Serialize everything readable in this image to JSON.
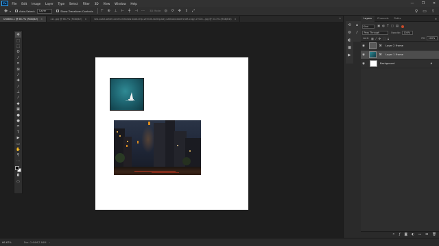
{
  "menu": {
    "logo": "Ps",
    "items": [
      "File",
      "Edit",
      "Image",
      "Layer",
      "Type",
      "Select",
      "Filter",
      "3D",
      "View",
      "Window",
      "Help"
    ]
  },
  "window_controls": {
    "minimize": "—",
    "restore": "❐",
    "close": "✕"
  },
  "options_bar": {
    "auto_select_label": "Auto-Select:",
    "auto_select_value": "Layer",
    "transform_controls_label": "Show Transform Controls",
    "mode_3d_label": "3D Mode:"
  },
  "tabs": [
    {
      "title": "Untitled-1 @ 66.7% (RGB/8#)",
      "active": true
    },
    {
      "title": "111.jpg @ 66.7% (RGB/8#)",
      "active": false
    },
    {
      "title": "sea-coast-water-ocean-meadow-boat-ship-vehicle-sailing-bay-sailboat-watercraft-copy-1700x...jpg @ 33.3% (RGB/8#)",
      "active": false
    }
  ],
  "tools": [
    {
      "icon": "move-icon",
      "glyph": "✥"
    },
    {
      "icon": "artboard-icon",
      "glyph": "⬚"
    },
    {
      "icon": "marquee-icon",
      "glyph": "⬚"
    },
    {
      "icon": "lasso-icon",
      "glyph": "ʘ"
    },
    {
      "icon": "quick-select-icon",
      "glyph": "⁄"
    },
    {
      "icon": "crop-icon",
      "glyph": "⌗"
    },
    {
      "icon": "frame-icon",
      "glyph": "⊠"
    },
    {
      "icon": "eyedropper-icon",
      "glyph": "⁄"
    },
    {
      "icon": "healing-icon",
      "glyph": "✚"
    },
    {
      "icon": "brush-icon",
      "glyph": "⁄"
    },
    {
      "icon": "stamp-icon",
      "glyph": "⊥"
    },
    {
      "icon": "history-brush-icon",
      "glyph": "⁄"
    },
    {
      "icon": "eraser-icon",
      "glyph": "◆"
    },
    {
      "icon": "gradient-icon",
      "glyph": "▣"
    },
    {
      "icon": "blur-icon",
      "glyph": "●"
    },
    {
      "icon": "dodge-icon",
      "glyph": "●"
    },
    {
      "icon": "pen-icon",
      "glyph": "✒"
    },
    {
      "icon": "type-icon",
      "glyph": "T"
    },
    {
      "icon": "path-select-icon",
      "glyph": "▶"
    },
    {
      "icon": "rectangle-icon",
      "glyph": "▭"
    },
    {
      "icon": "hand-icon",
      "glyph": "✋"
    },
    {
      "icon": "zoom-icon",
      "glyph": "⚲"
    },
    {
      "icon": "more-tools-icon",
      "glyph": "···"
    }
  ],
  "right_strip": [
    {
      "icon": "history-icon",
      "glyph": "⟲"
    },
    {
      "icon": "properties-icon",
      "glyph": "⚙"
    },
    {
      "icon": "adjustments-icon",
      "glyph": "◐"
    },
    {
      "icon": "swatches-icon",
      "glyph": "▦"
    },
    {
      "icon": "actions-icon",
      "glyph": "▶"
    }
  ],
  "layers_panel": {
    "tabs": [
      "Layers",
      "Channels",
      "Paths"
    ],
    "kind": "Kind",
    "blend_mode": "Pass Through",
    "opacity_label": "Opacity:",
    "opacity": "100%",
    "lock_label": "Lock:",
    "fill_label": "Fill:",
    "fill": "100%",
    "layers": [
      {
        "name": "Layer 2 Frame",
        "thumb": "frame",
        "selected": false,
        "lock": false
      },
      {
        "name": "Layer 1 Frame",
        "thumb": "sea",
        "selected": true,
        "lock": false
      },
      {
        "name": "Background",
        "thumb": "white",
        "selected": false,
        "lock": true
      }
    ]
  },
  "status": {
    "zoom": "66.67%",
    "doc_size": "Doc: 2.64M/7.84M"
  },
  "colors": {
    "ps_blue": "#31a8ff",
    "canvas_bg": "#1e1e1e",
    "panel_bg": "#2e2e2e",
    "selected_layer": "#4d4d4d"
  }
}
